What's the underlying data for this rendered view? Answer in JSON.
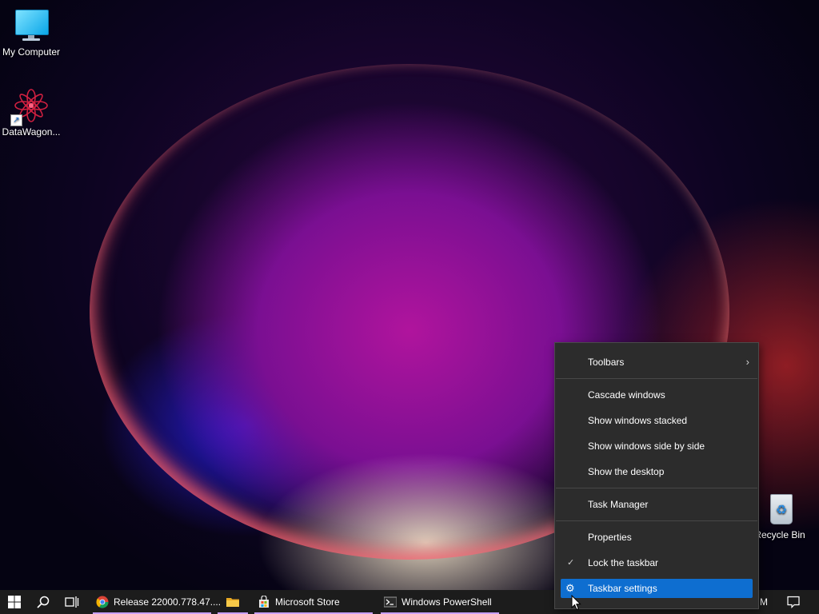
{
  "desktop": {
    "icons": [
      {
        "label": "My Computer",
        "icon": "monitor-icon"
      },
      {
        "label": "DataWagon...",
        "icon": "datawagon-icon"
      },
      {
        "label": "Recycle Bin",
        "icon": "recycle-bin-icon"
      }
    ]
  },
  "taskbar": {
    "start_icon": "windows-logo-icon",
    "search_icon": "search-icon",
    "taskview_icon": "task-view-icon",
    "apps": [
      {
        "label": "Release 22000.778.47....",
        "icon": "chrome-icon",
        "running": true
      },
      {
        "label": "",
        "icon": "file-explorer-icon",
        "running": true
      },
      {
        "label": "Microsoft Store",
        "icon": "microsoft-store-icon",
        "running": true
      },
      {
        "label": "Windows PowerShell",
        "icon": "powershell-icon",
        "running": true
      }
    ],
    "clock_partial": "M",
    "notification_icon": "notification-icon"
  },
  "context_menu": {
    "items": [
      {
        "label": "Toolbars",
        "submenu": true
      },
      {
        "label": "Cascade windows"
      },
      {
        "label": "Show windows stacked"
      },
      {
        "label": "Show windows side by side"
      },
      {
        "label": "Show the desktop"
      },
      {
        "label": "Task Manager"
      },
      {
        "label": "Properties"
      },
      {
        "label": "Lock the taskbar",
        "checked": true
      },
      {
        "label": "Taskbar settings",
        "highlighted": true
      }
    ]
  },
  "colors": {
    "accent": "#0e6ed0",
    "taskbar_bg": "#1c1c1c",
    "menu_bg": "#2c2c2c"
  }
}
